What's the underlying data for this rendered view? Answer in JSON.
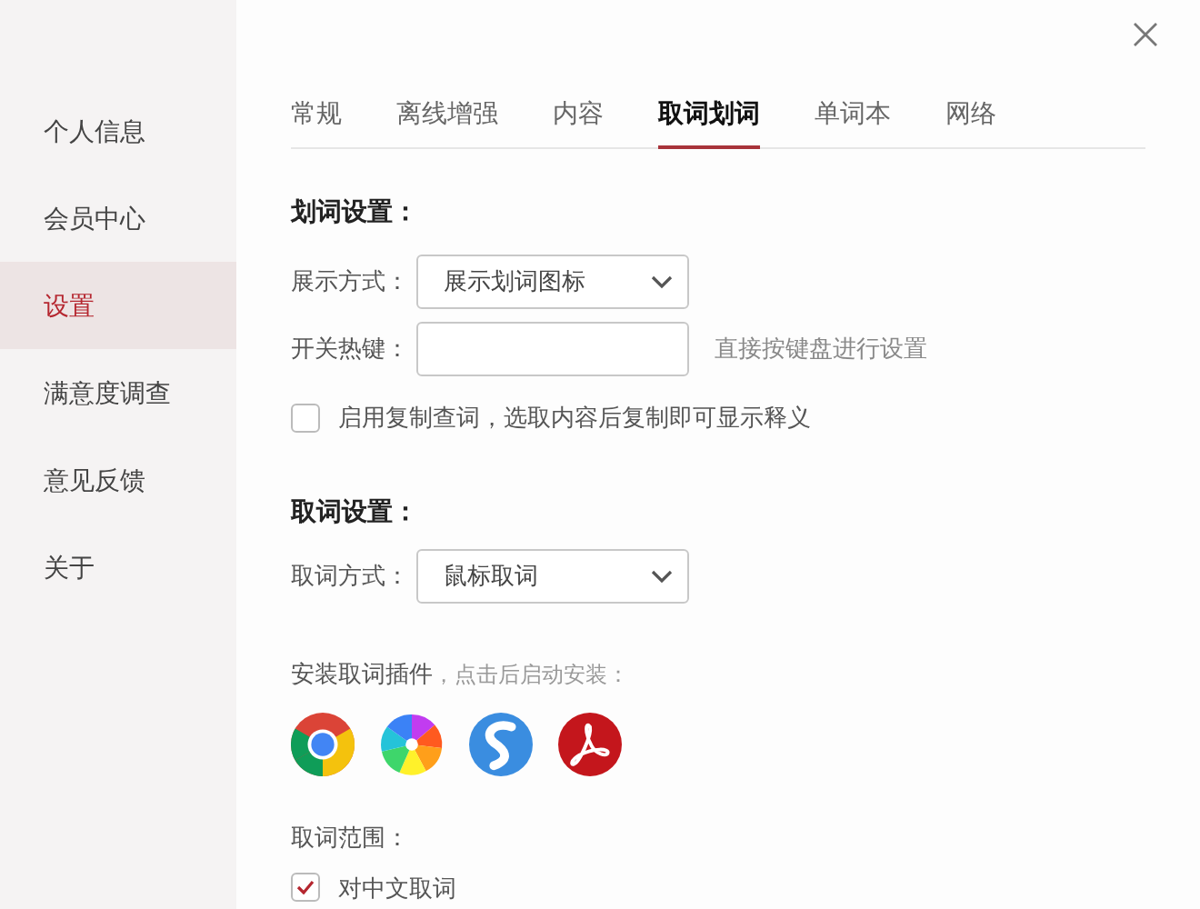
{
  "sidebar": {
    "items": [
      {
        "label": "个人信息",
        "selected": false
      },
      {
        "label": "会员中心",
        "selected": false
      },
      {
        "label": "设置",
        "selected": true
      },
      {
        "label": "满意度调查",
        "selected": false
      },
      {
        "label": "意见反馈",
        "selected": false
      },
      {
        "label": "关于",
        "selected": false
      }
    ]
  },
  "tabs": [
    {
      "label": "常规",
      "selected": false
    },
    {
      "label": "离线增强",
      "selected": false
    },
    {
      "label": "内容",
      "selected": false
    },
    {
      "label": "取词划词",
      "selected": true
    },
    {
      "label": "单词本",
      "selected": false
    },
    {
      "label": "网络",
      "selected": false
    }
  ],
  "highlight_section": {
    "title": "划词设置：",
    "display_mode": {
      "label": "展示方式：",
      "value": "展示划词图标"
    },
    "hotkey": {
      "label": "开关热键：",
      "hint": "直接按键盘进行设置"
    },
    "copy_lookup": {
      "label": "启用复制查词，选取内容后复制即可显示释义",
      "checked": false
    }
  },
  "pick_section": {
    "title": "取词设置：",
    "pick_mode": {
      "label": "取词方式：",
      "value": "鼠标取词"
    },
    "plugins_label": "安装取词插件",
    "plugins_hint": "，点击后启动安装：",
    "plugins": [
      {
        "kind": "chrome"
      },
      {
        "kind": "pinwheel"
      },
      {
        "kind": "swirl"
      },
      {
        "kind": "acrobat"
      }
    ],
    "range_label": "取词范围：",
    "range_options": [
      {
        "label": "对中文取词",
        "checked": true
      }
    ]
  }
}
